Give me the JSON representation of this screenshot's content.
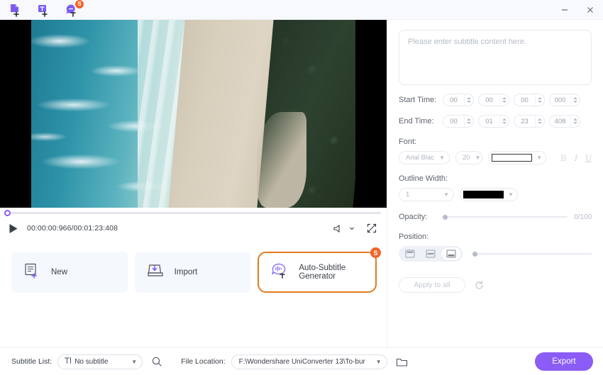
{
  "titlebar": {
    "icons": [
      {
        "name": "new-subtitle-file-icon",
        "badge": null
      },
      {
        "name": "add-text-track-icon",
        "badge": null
      },
      {
        "name": "auto-subtitle-icon",
        "badge": "S"
      }
    ],
    "minimize_label": "–",
    "close_label": "✕"
  },
  "player": {
    "timecode": "00:00:00:966/00:01:23:408",
    "current_time": "00:00:00:966",
    "total_time": "00:01:23:408",
    "play_label": "play",
    "progress_percent": 1,
    "volume_icon": "speaker-icon",
    "fullscreen_icon": "fullscreen-icon"
  },
  "cards": [
    {
      "label": "New",
      "icon": "new-document-icon",
      "badge": null,
      "highlight": false
    },
    {
      "label": "Import",
      "icon": "import-tray-icon",
      "badge": null,
      "highlight": false
    },
    {
      "label": "Auto-Subtitle Generator",
      "icon": "speech-waveform-icon",
      "badge": "S",
      "highlight": true
    }
  ],
  "panel": {
    "subtitle_placeholder": "Please enter subtitle content here.",
    "subtitle_value": "",
    "start_time": {
      "label": "Start Time:",
      "hours": "00",
      "minutes": "00",
      "seconds": "00",
      "millis": "000"
    },
    "end_time": {
      "label": "End Time:",
      "hours": "00",
      "minutes": "01",
      "seconds": "23",
      "millis": "408"
    },
    "font": {
      "label": "Font:",
      "family": "Arial Blac",
      "size": "20",
      "color": "#ffffff",
      "bold_label": "B",
      "italic_label": "I",
      "underline_label": "U"
    },
    "outline": {
      "label": "Outline Width:",
      "width": "1",
      "color": "#000000"
    },
    "opacity": {
      "label": "Opacity:",
      "value": "0/100",
      "percent": 0
    },
    "position": {
      "label": "Position:",
      "options": [
        "top",
        "middle",
        "bottom"
      ],
      "selected": "bottom",
      "offset_percent": 0
    },
    "apply_label": "Apply to all",
    "reset_icon": "reset-icon"
  },
  "footer": {
    "subtitle_list_label": "Subtitle List:",
    "subtitle_list_value": "No subtitle",
    "search_icon": "search-icon",
    "file_location_label": "File Location:",
    "file_location_value": "F:\\Wondershare UniConverter 13\\To-bur",
    "folder_icon": "folder-icon",
    "export_label": "Export"
  },
  "colors": {
    "accent": "#8b5cf6",
    "badge": "#f2642a",
    "highlight_border": "#e07b22"
  }
}
